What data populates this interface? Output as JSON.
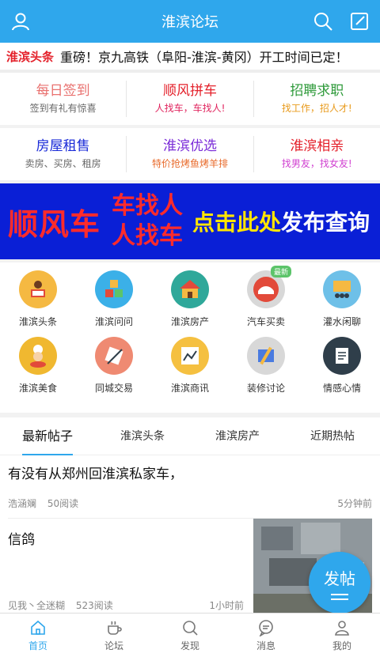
{
  "header": {
    "title": "淮滨论坛"
  },
  "ticker": {
    "tag": "淮滨头条",
    "text": "重磅！京九高铁（阜阳-淮滨-黄冈）开工时间已定！"
  },
  "menu_rows": [
    [
      {
        "title": "每日签到",
        "sub": "签到有礼有惊喜",
        "title_color": "#e9716f",
        "sub_color": "#666666"
      },
      {
        "title": "顺风拼车",
        "sub": "人找车，车找人!",
        "title_color": "#e4212b",
        "sub_color": "#e0245e"
      },
      {
        "title": "招聘求职",
        "sub": "找工作，招人才!",
        "title_color": "#2e9a3a",
        "sub_color": "#e89a1b"
      }
    ],
    [
      {
        "title": "房屋租售",
        "sub": "卖房、买房、租房",
        "title_color": "#1a2bd8",
        "sub_color": "#666666"
      },
      {
        "title": "淮滨优选",
        "sub": "特价抢烤鱼烤羊排",
        "title_color": "#7a2bd8",
        "sub_color": "#e86a2a"
      },
      {
        "title": "淮滨相亲",
        "sub": "找男友，找女友!",
        "title_color": "#e4212b",
        "sub_color": "#d03fd0"
      }
    ]
  ],
  "banner": {
    "left": "顺风车",
    "mid1": "车找人",
    "mid2": "人找车",
    "cta_yellow": "点击此处",
    "cta_white": "发布查询"
  },
  "icons": [
    {
      "label": "淮滨头条",
      "icon": "news-reader-icon",
      "color": "#f5b942",
      "badge": ""
    },
    {
      "label": "淮滨问问",
      "icon": "blocks-123-icon",
      "color": "#3bb0e8",
      "badge": ""
    },
    {
      "label": "淮滨房产",
      "icon": "house-icon",
      "color": "#2fa89a",
      "badge": ""
    },
    {
      "label": "汽车买卖",
      "icon": "car-icon",
      "color": "#d8d8d8",
      "badge": "最新"
    },
    {
      "label": "灌水闲聊",
      "icon": "chat-board-icon",
      "color": "#6ec0e8",
      "badge": ""
    },
    {
      "label": "淮滨美食",
      "icon": "chef-icon",
      "color": "#f0b830",
      "badge": ""
    },
    {
      "label": "同城交易",
      "icon": "trade-tools-icon",
      "color": "#ef8a72",
      "badge": ""
    },
    {
      "label": "淮滨商讯",
      "icon": "trend-chart-icon",
      "color": "#f5c040",
      "badge": ""
    },
    {
      "label": "装修讨论",
      "icon": "paint-brush-icon",
      "color": "#d8d8d8",
      "badge": ""
    },
    {
      "label": "情感心情",
      "icon": "notepad-icon",
      "color": "#2f3e4a",
      "badge": ""
    }
  ],
  "tabs": [
    "最新帖子",
    "淮滨头条",
    "淮滨房产",
    "近期热帖"
  ],
  "posts": [
    {
      "title": "有没有从郑州回淮滨私家车，",
      "author": "浩涵斓",
      "reads": "50阅读",
      "time": "5分钟前"
    },
    {
      "title": "信鸽",
      "author": "见我丶全迷糊",
      "reads": "523阅读",
      "time": "1小时前"
    }
  ],
  "fab": {
    "label": "发帖"
  },
  "bottom_nav": [
    {
      "label": "首页",
      "icon": "home-icon",
      "active": true
    },
    {
      "label": "论坛",
      "icon": "coffee-cup-icon",
      "active": false
    },
    {
      "label": "发现",
      "icon": "discover-icon",
      "active": false
    },
    {
      "label": "消息",
      "icon": "message-icon",
      "active": false
    },
    {
      "label": "我的",
      "icon": "profile-icon",
      "active": false
    }
  ],
  "colors": {
    "primary": "#2fa7ec",
    "banner_bg": "#0a1fd6",
    "accent_red": "#e4212b"
  }
}
